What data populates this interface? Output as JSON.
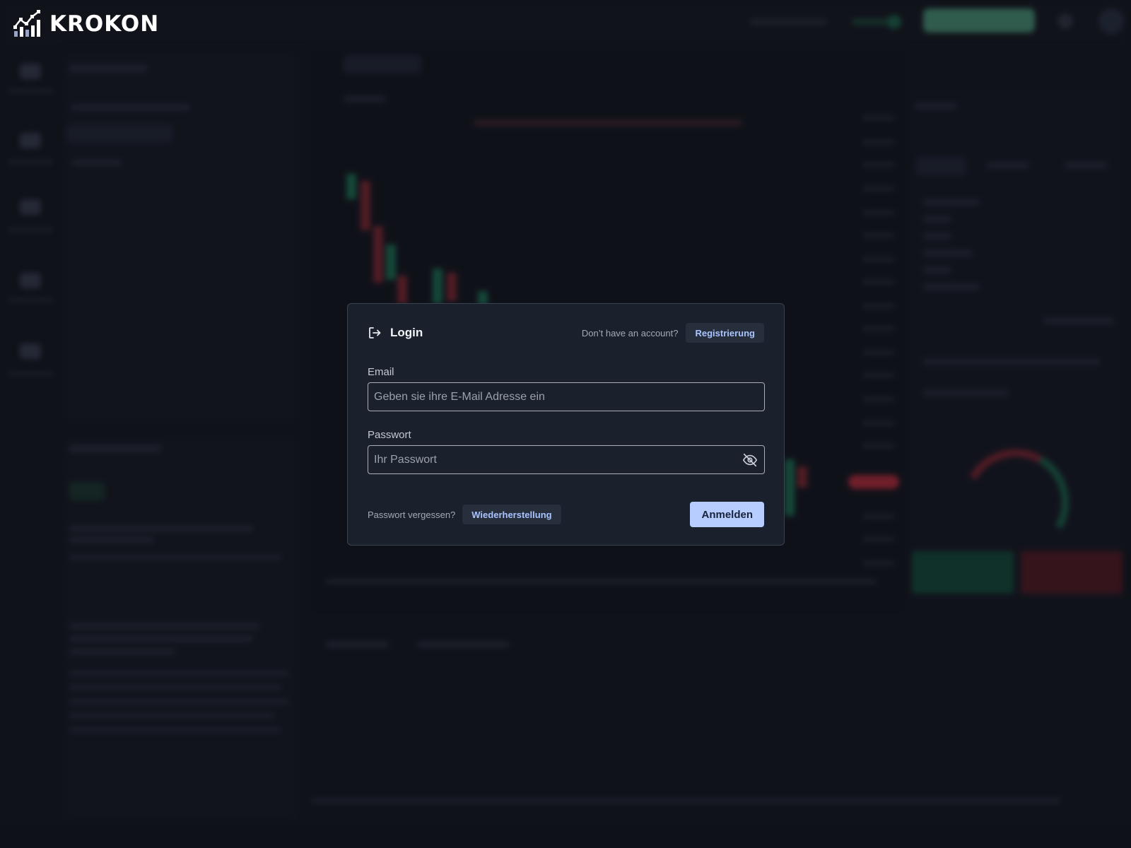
{
  "app": {
    "brand": "KROKON"
  },
  "login_modal": {
    "title": "Login",
    "signup_prompt": "Don’t have an account?",
    "signup_button": "Registrierung",
    "email": {
      "label": "Email",
      "placeholder": "Geben sie ihre E-Mail Adresse ein",
      "value": ""
    },
    "password": {
      "label": "Passwort",
      "placeholder": "Ihr Passwort",
      "value": ""
    },
    "forgot_prompt": "Passwort vergessen?",
    "recover_button": "Wiederherstellung",
    "submit_button": "Anmelden"
  },
  "icons": {
    "logo": "bar-chart-logo-icon",
    "login": "login-arrow-icon",
    "password_toggle": "eye-off-icon"
  },
  "colors": {
    "background": "#151922",
    "modal": "#1b212c",
    "accent": "#b8cdff",
    "link": "#a9c4ff",
    "buy": "#1f7a59",
    "sell": "#c2303e"
  }
}
